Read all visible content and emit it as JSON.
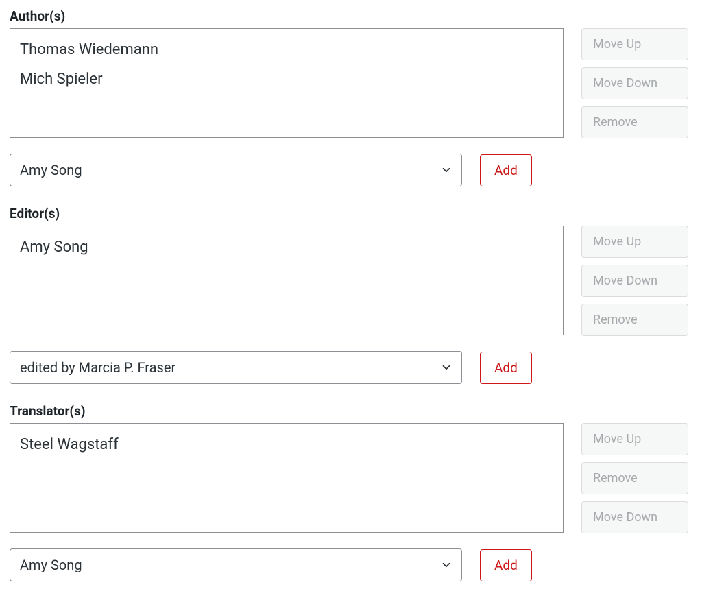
{
  "sections": [
    {
      "label": "Author(s)",
      "items": [
        "Thomas Wiedemann",
        "Mich Spieler"
      ],
      "select_value": "Amy Song",
      "add_label": "Add",
      "buttons": {
        "move_up": "Move Up",
        "move_down": "Move Down",
        "remove": "Remove"
      }
    },
    {
      "label": "Editor(s)",
      "items": [
        "Amy Song"
      ],
      "select_value": "edited by Marcia P. Fraser",
      "add_label": "Add",
      "buttons": {
        "move_up": "Move Up",
        "move_down": "Move Down",
        "remove": "Remove"
      }
    },
    {
      "label": "Translator(s)",
      "items": [
        "Steel Wagstaff"
      ],
      "select_value": "Amy Song",
      "add_label": "Add",
      "buttons": {
        "move_up": "Move Up",
        "move_down": "Move Down",
        "remove": "Remove"
      }
    }
  ]
}
